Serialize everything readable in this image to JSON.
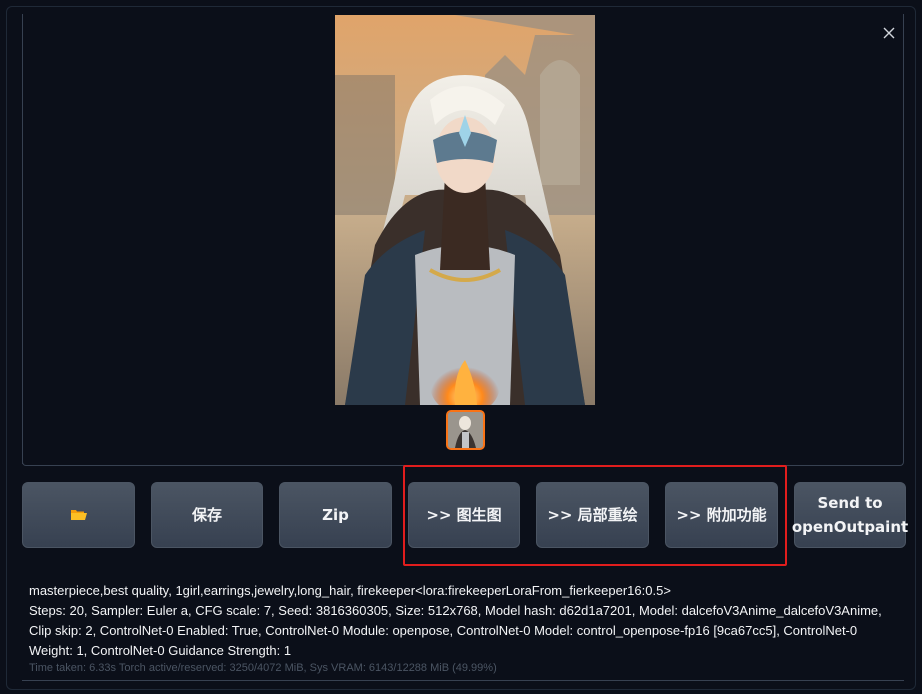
{
  "gallery": {
    "close_icon": "close-icon",
    "main_image_alt": "",
    "thumbnail_count": 1
  },
  "actions": {
    "folder_icon": "folder-icon",
    "save_label": "保存",
    "zip_label": "Zip",
    "img2img_label": ">> 图生图",
    "inpaint_label": ">> 局部重绘",
    "extras_label": ">> 附加功能",
    "send_openoutpaint_line1": "Send to",
    "send_openoutpaint_line2": "openOutpaint"
  },
  "generation_info": {
    "prompt": "masterpiece,best quality, 1girl,earrings,jewelry,long_hair, firekeeper<lora:firekeeperLoraFrom_fierkeeper16:0.5>",
    "params": "Steps: 20, Sampler: Euler a, CFG scale: 7, Seed: 3816360305, Size: 512x768, Model hash: d62d1a7201, Model: dalcefoV3Anime_dalcefoV3Anime, Clip skip: 2, ControlNet-0 Enabled: True, ControlNet-0 Module: openpose, ControlNet-0 Model: control_openpose-fp16 [9ca67cc5], ControlNet-0 Weight: 1, ControlNet-0 Guidance Strength: 1"
  },
  "timing": "Time taken: 6.33s  Torch active/reserved: 3250/4072 MiB, Sys VRAM: 6143/12288 MiB (49.99%)",
  "colors": {
    "background": "#0b0f19",
    "button": "#374151",
    "selected_thumb_border": "#f97316",
    "highlight_box": "#e11d1d"
  }
}
